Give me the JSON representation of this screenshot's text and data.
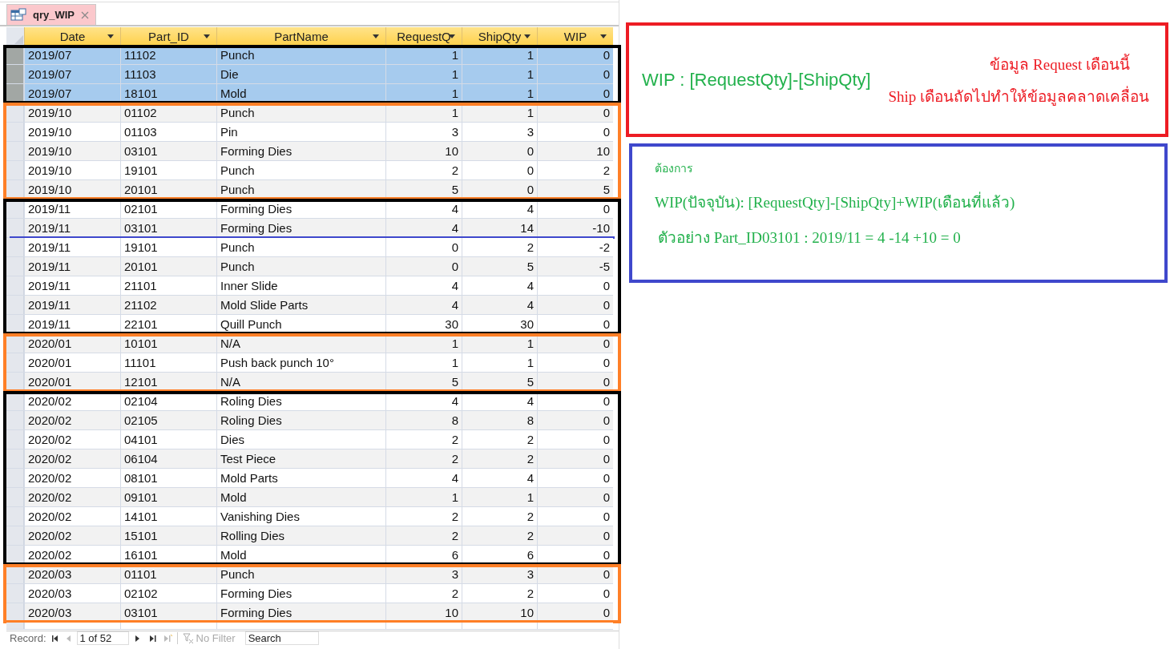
{
  "tab": {
    "title": "qry_WIP"
  },
  "table": {
    "columns": [
      "Date",
      "Part_ID",
      "PartName",
      "RequestQ",
      "ShipQty",
      "WIP"
    ],
    "groups": [
      {
        "color": "#000000",
        "rows": [
          {
            "date": "2019/07",
            "part_id": "11102",
            "part_name": "Punch",
            "request_qty": "1",
            "ship_qty": "1",
            "wip": "0",
            "selected": true,
            "marked": false
          },
          {
            "date": "2019/07",
            "part_id": "11103",
            "part_name": "Die",
            "request_qty": "1",
            "ship_qty": "1",
            "wip": "0",
            "selected": true,
            "marked": false
          },
          {
            "date": "2019/07",
            "part_id": "18101",
            "part_name": "Mold",
            "request_qty": "1",
            "ship_qty": "1",
            "wip": "0",
            "selected": true,
            "marked": false
          }
        ]
      },
      {
        "color": "#ff7f27",
        "rows": [
          {
            "date": "2019/10",
            "part_id": "01102",
            "part_name": "Punch",
            "request_qty": "1",
            "ship_qty": "1",
            "wip": "0",
            "selected": false,
            "marked": false
          },
          {
            "date": "2019/10",
            "part_id": "01103",
            "part_name": "Pin",
            "request_qty": "3",
            "ship_qty": "3",
            "wip": "0",
            "selected": false,
            "marked": false
          },
          {
            "date": "2019/10",
            "part_id": "03101",
            "part_name": "Forming Dies",
            "request_qty": "10",
            "ship_qty": "0",
            "wip": "10",
            "selected": false,
            "marked": false
          },
          {
            "date": "2019/10",
            "part_id": "19101",
            "part_name": "Punch",
            "request_qty": "2",
            "ship_qty": "0",
            "wip": "2",
            "selected": false,
            "marked": false
          },
          {
            "date": "2019/10",
            "part_id": "20101",
            "part_name": "Punch",
            "request_qty": "5",
            "ship_qty": "0",
            "wip": "5",
            "selected": false,
            "marked": false
          }
        ]
      },
      {
        "color": "#000000",
        "rows": [
          {
            "date": "2019/11",
            "part_id": "02101",
            "part_name": "Forming Dies",
            "request_qty": "4",
            "ship_qty": "4",
            "wip": "0",
            "selected": false,
            "marked": false
          },
          {
            "date": "2019/11",
            "part_id": "03101",
            "part_name": "Forming Dies",
            "request_qty": "4",
            "ship_qty": "14",
            "wip": "-10",
            "selected": false,
            "marked": true
          },
          {
            "date": "2019/11",
            "part_id": "19101",
            "part_name": "Punch",
            "request_qty": "0",
            "ship_qty": "2",
            "wip": "-2",
            "selected": false,
            "marked": false
          },
          {
            "date": "2019/11",
            "part_id": "20101",
            "part_name": "Punch",
            "request_qty": "0",
            "ship_qty": "5",
            "wip": "-5",
            "selected": false,
            "marked": false
          },
          {
            "date": "2019/11",
            "part_id": "21101",
            "part_name": "Inner Slide",
            "request_qty": "4",
            "ship_qty": "4",
            "wip": "0",
            "selected": false,
            "marked": false
          },
          {
            "date": "2019/11",
            "part_id": "21102",
            "part_name": "Mold Slide Parts",
            "request_qty": "4",
            "ship_qty": "4",
            "wip": "0",
            "selected": false,
            "marked": false
          },
          {
            "date": "2019/11",
            "part_id": "22101",
            "part_name": "Quill Punch",
            "request_qty": "30",
            "ship_qty": "30",
            "wip": "0",
            "selected": false,
            "marked": false
          }
        ]
      },
      {
        "color": "#ff7f27",
        "rows": [
          {
            "date": "2020/01",
            "part_id": "10101",
            "part_name": "N/A",
            "request_qty": "1",
            "ship_qty": "1",
            "wip": "0",
            "selected": false,
            "marked": false
          },
          {
            "date": "2020/01",
            "part_id": "11101",
            "part_name": "Push back punch 10°",
            "request_qty": "1",
            "ship_qty": "1",
            "wip": "0",
            "selected": false,
            "marked": false
          },
          {
            "date": "2020/01",
            "part_id": "12101",
            "part_name": "N/A",
            "request_qty": "5",
            "ship_qty": "5",
            "wip": "0",
            "selected": false,
            "marked": false
          }
        ]
      },
      {
        "color": "#000000",
        "rows": [
          {
            "date": "2020/02",
            "part_id": "02104",
            "part_name": "Roling Dies",
            "request_qty": "4",
            "ship_qty": "4",
            "wip": "0",
            "selected": false,
            "marked": false
          },
          {
            "date": "2020/02",
            "part_id": "02105",
            "part_name": "Roling Dies",
            "request_qty": "8",
            "ship_qty": "8",
            "wip": "0",
            "selected": false,
            "marked": false
          },
          {
            "date": "2020/02",
            "part_id": "04101",
            "part_name": "Dies",
            "request_qty": "2",
            "ship_qty": "2",
            "wip": "0",
            "selected": false,
            "marked": false
          },
          {
            "date": "2020/02",
            "part_id": "06104",
            "part_name": "Test Piece",
            "request_qty": "2",
            "ship_qty": "2",
            "wip": "0",
            "selected": false,
            "marked": false
          },
          {
            "date": "2020/02",
            "part_id": "08101",
            "part_name": "Mold Parts",
            "request_qty": "4",
            "ship_qty": "4",
            "wip": "0",
            "selected": false,
            "marked": false
          },
          {
            "date": "2020/02",
            "part_id": "09101",
            "part_name": "Mold",
            "request_qty": "1",
            "ship_qty": "1",
            "wip": "0",
            "selected": false,
            "marked": false
          },
          {
            "date": "2020/02",
            "part_id": "14101",
            "part_name": "Vanishing Dies",
            "request_qty": "2",
            "ship_qty": "2",
            "wip": "0",
            "selected": false,
            "marked": false
          },
          {
            "date": "2020/02",
            "part_id": "15101",
            "part_name": "Rolling Dies",
            "request_qty": "2",
            "ship_qty": "2",
            "wip": "0",
            "selected": false,
            "marked": false
          },
          {
            "date": "2020/02",
            "part_id": "16101",
            "part_name": "Mold",
            "request_qty": "6",
            "ship_qty": "6",
            "wip": "0",
            "selected": false,
            "marked": false
          }
        ]
      },
      {
        "color": "#ff7f27",
        "rows": [
          {
            "date": "2020/03",
            "part_id": "01101",
            "part_name": "Punch",
            "request_qty": "3",
            "ship_qty": "3",
            "wip": "0",
            "selected": false,
            "marked": false
          },
          {
            "date": "2020/03",
            "part_id": "02102",
            "part_name": "Forming Dies",
            "request_qty": "2",
            "ship_qty": "2",
            "wip": "0",
            "selected": false,
            "marked": false
          },
          {
            "date": "2020/03",
            "part_id": "03101",
            "part_name": "Forming Dies",
            "request_qty": "10",
            "ship_qty": "10",
            "wip": "0",
            "selected": false,
            "marked": false
          }
        ]
      }
    ]
  },
  "record_bar": {
    "label": "Record:",
    "position": "1 of 52",
    "nav": [
      {
        "kind": "first",
        "disabled": false
      },
      {
        "kind": "prev",
        "disabled": true
      },
      {
        "kind": "next",
        "disabled": false
      },
      {
        "kind": "last",
        "disabled": false
      },
      {
        "kind": "new",
        "disabled": true
      }
    ],
    "filter": {
      "label": "No Filter",
      "disabled": true
    },
    "search": {
      "placeholder": "Search"
    }
  },
  "notes": {
    "formula": "WIP : [RequestQty]-[ShipQty]",
    "issue_lines": [
      "ข้อมูล Request เดือนนี้",
      "Ship เดือนถัดไปทำให้ข้อมูลคลาดเคลื่อน"
    ],
    "want_label": "ต้องการ",
    "want_formula": "WIP(ปัจจุบัน): [RequestQty]-[ShipQty]+WIP(เดือนที่แล้ว)",
    "example": "ตัวอย่าง Part_ID03101 : 2019/11 = 4 -14 +10 = 0"
  }
}
